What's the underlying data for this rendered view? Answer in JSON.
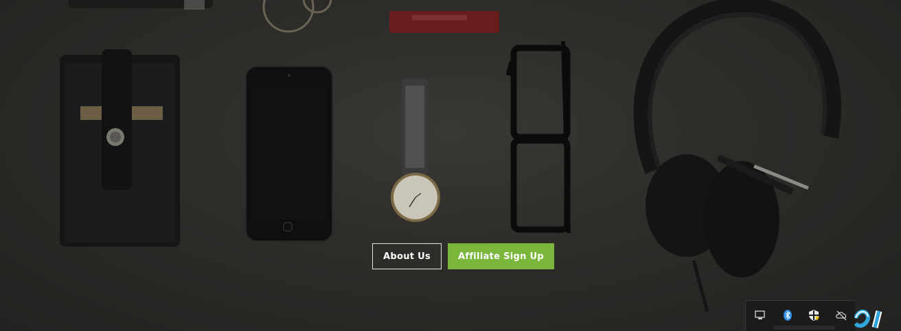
{
  "hero": {
    "buttons": {
      "about_label": "About Us",
      "affiliate_label": "Affiliate Sign Up"
    }
  },
  "colors": {
    "background": "#2e2c29",
    "affiliate_button": "#7ab53c",
    "about_button_border": "#e6e6e6",
    "bluetooth_icon": "#2f8de4",
    "logo_accent": "#31a6dc"
  },
  "system_tray": {
    "icons": [
      "display-icon",
      "bluetooth-icon",
      "security-shield-icon",
      "cloud-offline-icon"
    ]
  }
}
